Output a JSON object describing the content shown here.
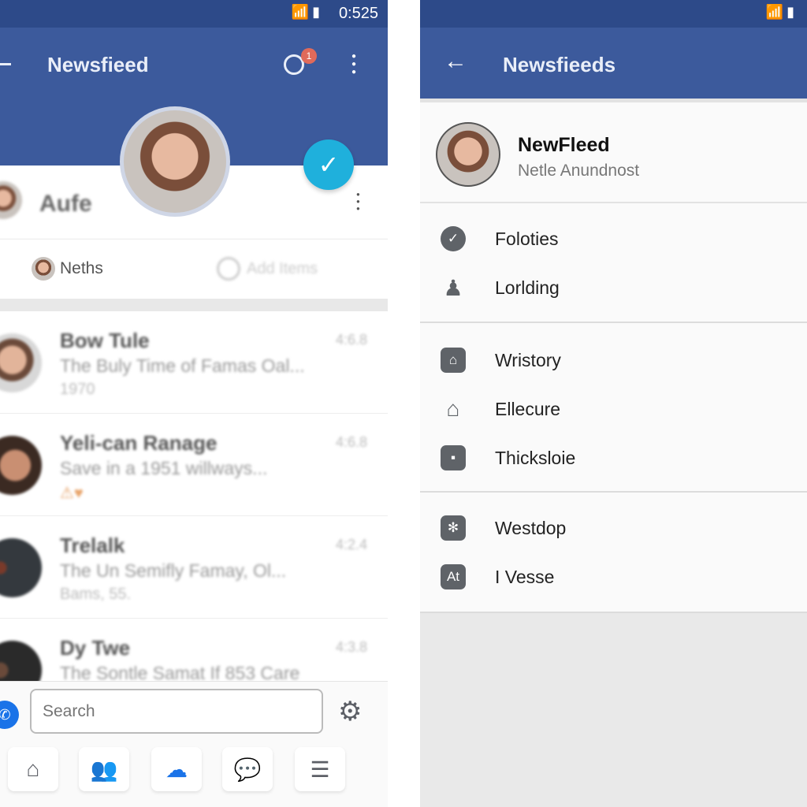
{
  "left": {
    "status": {
      "time": "0:525"
    },
    "appbar": {
      "title": "Newsfieed",
      "notification_count": "1"
    },
    "profile": {
      "name": "Aufe"
    },
    "tabs": [
      {
        "label": "Neths"
      },
      {
        "label": "Add Items"
      }
    ],
    "feed": [
      {
        "name": "Bow Tule",
        "text": "The Buly Time of Famas Oal...",
        "meta": "1970",
        "time": "4:6.8"
      },
      {
        "name": "Yeli-can Ranage",
        "text": "Save in a 1951 willways...",
        "meta": "⚠♥",
        "time": "4:6.8"
      },
      {
        "name": "Trelalk",
        "text": "The Un Semifly Famay, Ol...",
        "meta": "Bams, 55.",
        "time": "4:2.4"
      },
      {
        "name": "Dy Twe",
        "text": "The Sontle Samat If 853 Care",
        "meta": "",
        "time": "4:3.8"
      }
    ],
    "search": {
      "placeholder": "Search"
    },
    "accent": "#1a73e8"
  },
  "right": {
    "status": {
      "time": ""
    },
    "appbar": {
      "title": "Newsfieeds"
    },
    "profile": {
      "name": "NewFleed",
      "subtitle": "Netle Anundnost"
    },
    "menu_groups": [
      [
        {
          "icon": "check-circle",
          "label": "Foloties"
        },
        {
          "icon": "person",
          "label": "Lorlding"
        }
      ],
      [
        {
          "icon": "house-outline",
          "label": "Wristory"
        },
        {
          "icon": "house",
          "label": "Ellecure"
        },
        {
          "icon": "bag",
          "label": "Thicksloie"
        }
      ],
      [
        {
          "icon": "snowflake",
          "label": "Westdop"
        },
        {
          "icon": "at-box",
          "label": "I Vesse",
          "glyph": "At"
        }
      ]
    ]
  },
  "colors": {
    "header": "#3c5a9c",
    "status": "#2d4a89",
    "fab": "#1fb0dc"
  }
}
